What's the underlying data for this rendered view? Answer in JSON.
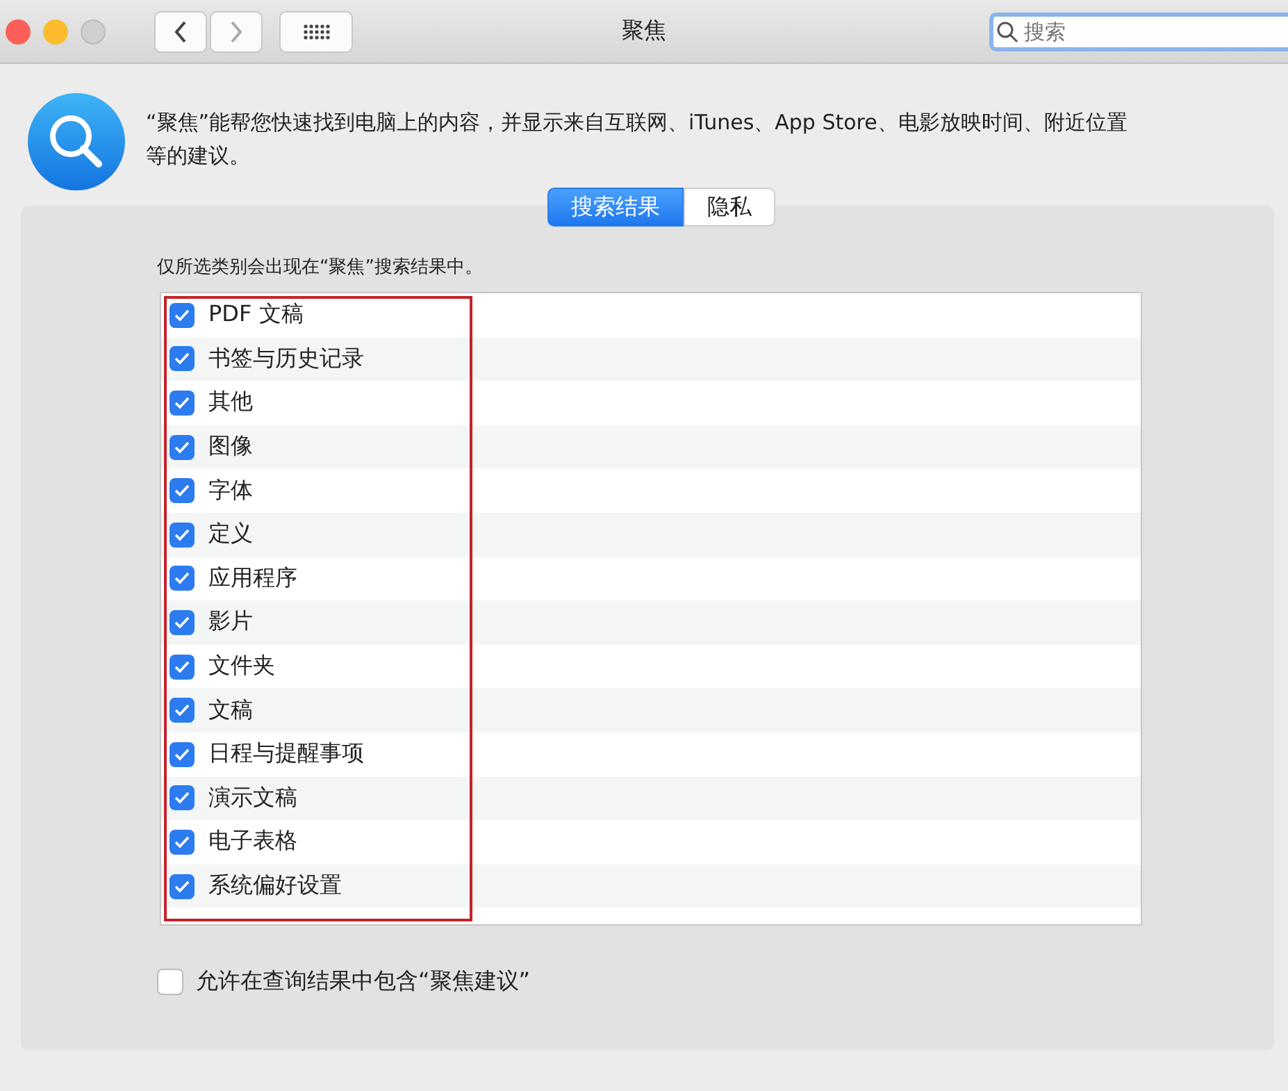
{
  "window": {
    "title": "聚焦"
  },
  "search": {
    "placeholder": "搜索"
  },
  "description": "“聚焦”能帮您快速找到电脑上的内容，并显示来自互联网、iTunes、App Store、电影放映时间、附近位置等的建议。",
  "tabs": [
    {
      "label": "搜索结果",
      "selected": true
    },
    {
      "label": "隐私",
      "selected": false
    }
  ],
  "hint": "仅所选类别会出现在“聚焦”搜索结果中。",
  "categories": [
    {
      "label": "PDF 文稿",
      "checked": true
    },
    {
      "label": "书签与历史记录",
      "checked": true
    },
    {
      "label": "其他",
      "checked": true
    },
    {
      "label": "图像",
      "checked": true
    },
    {
      "label": "字体",
      "checked": true
    },
    {
      "label": "定义",
      "checked": true
    },
    {
      "label": "应用程序",
      "checked": true
    },
    {
      "label": "影片",
      "checked": true
    },
    {
      "label": "文件夹",
      "checked": true
    },
    {
      "label": "文稿",
      "checked": true
    },
    {
      "label": "日程与提醒事项",
      "checked": true
    },
    {
      "label": "演示文稿",
      "checked": true
    },
    {
      "label": "电子表格",
      "checked": true
    },
    {
      "label": "系统偏好设置",
      "checked": true
    }
  ],
  "allow_suggestions": {
    "label": "允许在查询结果中包含“聚焦建议”",
    "checked": false
  }
}
